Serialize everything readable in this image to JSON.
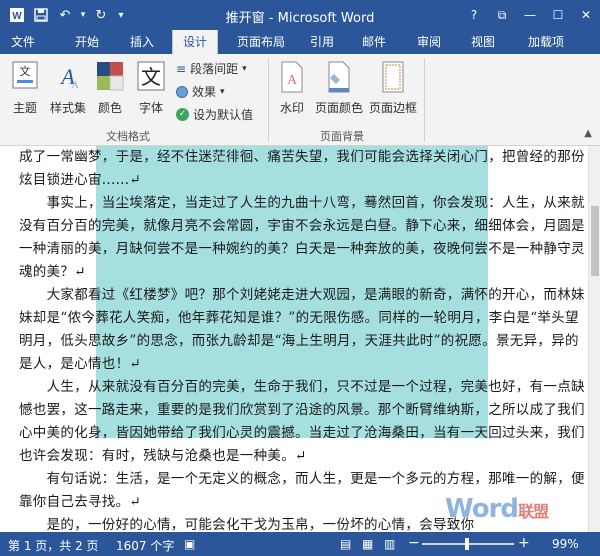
{
  "window": {
    "title": "推开窗 - Microsoft Word",
    "controls": {
      "help": "?",
      "ribbon_display": "⧉",
      "minimize": "—",
      "restore": "☐",
      "close": "✕"
    }
  },
  "quick_access": {
    "save_icon": "save-icon",
    "undo": "↶",
    "redo": "↻",
    "customize": "▾"
  },
  "tabs": [
    "文件",
    "开始",
    "插入",
    "设计",
    "页面布局",
    "引用",
    "邮件",
    "审阅",
    "视图",
    "加载项"
  ],
  "active_tab": "设计",
  "ribbon": {
    "doc_format": {
      "theme": "主题",
      "style_set": "样式集",
      "colors": "颜色",
      "fonts": "字体",
      "paragraph_spacing": "段落间距",
      "effects": "效果",
      "set_default": "设为默认值",
      "group_label": "文档格式"
    },
    "page_bg": {
      "watermark": "水印",
      "page_color": "页面颜色",
      "page_border": "页面边框",
      "group_label": "页面背景"
    }
  },
  "document": {
    "paragraphs": [
      "成了一常幽梦，于是，经不住迷茫徘徊、痛苦失望，我们可能会选择关闭心门，把曾经的那份炫目锁进心宙......↵",
      "　　事实上，当尘埃落定，当走过了人生的九曲十八弯，蓦然回首，你会发现：人生，从来就没有百分百的完美，就像月亮不会常圆，宇宙不会永远是白昼。静下心来，细细体会，月圆是一种清丽的美，月缺何尝不是一种婉约的美？白天是一种奔放的美，夜晚何尝不是一种静守灵魂的美？↵",
      "　　大家都看过《红楼梦》吧？那个刘姥姥走进大观园，是满眼的新奇，满怀的开心，而林妹妹却是“侬今葬花人笑痴，他年葬花知是谁？”的无限伤感。同样的一轮明月，李白是“举头望明月，低头思故乡”的思念，而张九龄却是“海上生明月，天涯共此时”的祝愿。景无异，异的是人，是心情也！↵",
      "　　人生，从来就没有百分百的完美，生命于我们，只不过是一个过程，完美也好，有一点缺憾也罢，这一路走来，重要的是我们欣赏到了沿途的风景。那个断臂维纳斯，之所以成了我们心中美的化身，皆因她带给了我们心灵的震撼。当走过了沧海桑田，当有一天回过头来，我们也许会发现：有时，残缺与沧桑也是一种美。↵",
      "　　有句话说：生活，是一个无定义的概念，而人生，更是一个多元的方程，那唯一的解，便靠你自己去寻找。↵",
      "　　是的，一份好的心情，可能会化干戈为玉帛，一份坏的心情，会导致你"
    ]
  },
  "status_bar": {
    "page": "第 1 页，共 2 页",
    "words": "1607 个字",
    "zoom": "99%",
    "zoom_minus": "−",
    "zoom_plus": "+",
    "zoom_level": 0.99
  },
  "logo": {
    "text": "Word",
    "cn": "联盟"
  },
  "colors": {
    "accent": "#2b579a",
    "watermark_bg": "#a6dfdf"
  }
}
